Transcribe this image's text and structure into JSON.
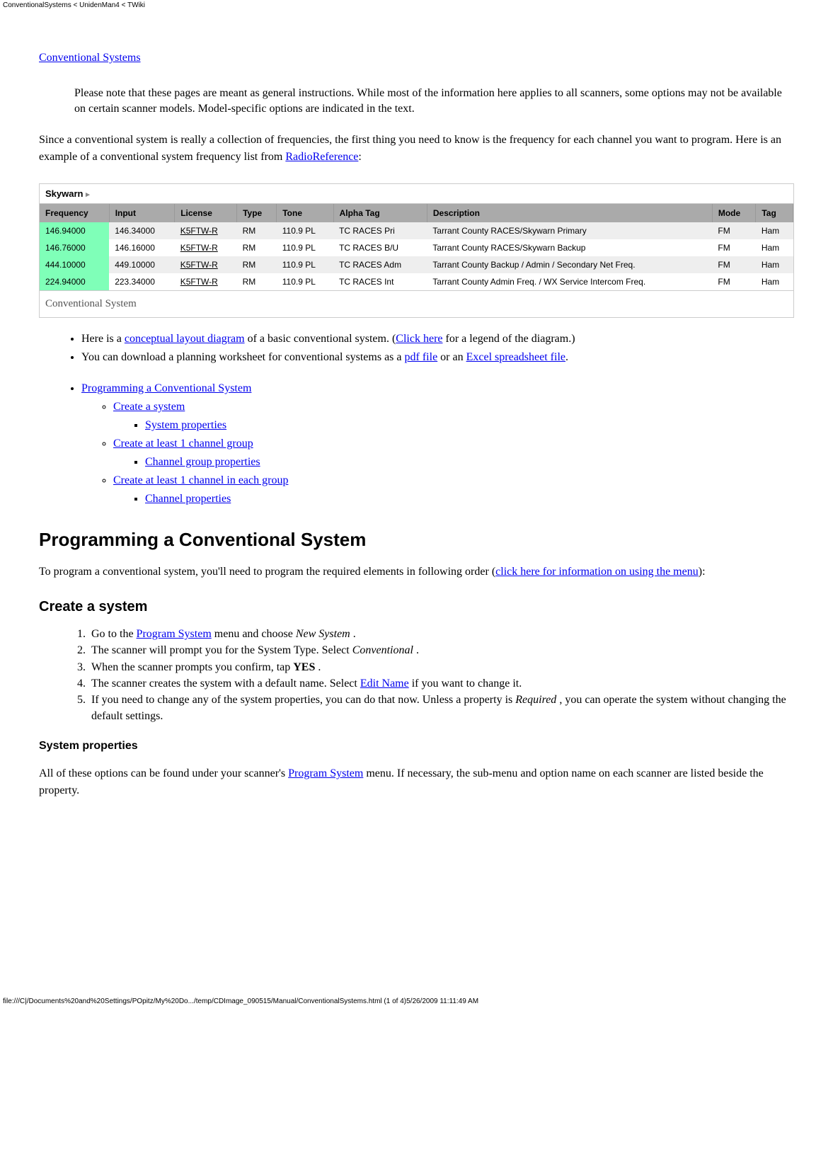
{
  "header_text": "ConventionalSystems < UnidenMan4 < TWiki",
  "title_link": "Conventional Systems",
  "note_para": "Please note that these pages are meant as general instructions. While most of the information here applies to all scanners, some options may not be available on certain scanner models. Model-specific options are indicated in the text.",
  "intro_pre": "Since a conventional system is really a collection of frequencies, the first thing you need to know is the frequency for each channel you want to program. Here is an example of a conventional system frequency list from ",
  "intro_link": "RadioReference",
  "intro_post": ":",
  "skywarn_label": "Skywarn",
  "table_headers": [
    "Frequency",
    "Input",
    "License",
    "Type",
    "Tone",
    "Alpha Tag",
    "Description",
    "Mode",
    "Tag"
  ],
  "rows": [
    {
      "freq": "146.94000",
      "input": "146.34000",
      "lic": "K5FTW-R",
      "type": "RM",
      "tone": "110.9 PL",
      "tag": "TC RACES Pri",
      "desc": "Tarrant County RACES/Skywarn Primary",
      "mode": "FM",
      "cat": "Ham"
    },
    {
      "freq": "146.76000",
      "input": "146.16000",
      "lic": "K5FTW-R",
      "type": "RM",
      "tone": "110.9 PL",
      "tag": "TC RACES B/U",
      "desc": "Tarrant County RACES/Skywarn Backup",
      "mode": "FM",
      "cat": "Ham"
    },
    {
      "freq": "444.10000",
      "input": "449.10000",
      "lic": "K5FTW-R",
      "type": "RM",
      "tone": "110.9 PL",
      "tag": "TC RACES Adm",
      "desc": "Tarrant County Backup / Admin / Secondary Net Freq.",
      "mode": "FM",
      "cat": "Ham"
    },
    {
      "freq": "224.94000",
      "input": "223.34000",
      "lic": "K5FTW-R",
      "type": "RM",
      "tone": "110.9 PL",
      "tag": "TC RACES Int",
      "desc": "Tarrant County Admin Freq. / WX Service Intercom Freq.",
      "mode": "FM",
      "cat": "Ham"
    }
  ],
  "caption": "Conventional System",
  "b1_pre": "Here is a ",
  "b1_l1": "conceptual layout diagram",
  "b1_mid": " of a basic conventional system. (",
  "b1_l2": "Click here",
  "b1_post": " for a legend of the diagram.)",
  "b2_pre": "You can download a planning worksheet for conventional systems as a ",
  "b2_l1": "pdf file",
  "b2_mid": " or an ",
  "b2_l2": "Excel spreadsheet file",
  "b2_post": ".",
  "toc": {
    "l1": "Programming a Conventional System",
    "l2a": "Create a system",
    "l3a": "System properties",
    "l2b": "Create at least 1 channel group",
    "l3b": "Channel group properties",
    "l2c": "Create at least 1 channel in each group",
    "l3c": "Channel properties"
  },
  "h1": "Programming a Conventional System",
  "prog_para_pre": "To program a conventional system, you'll need to program the required elements in following order (",
  "prog_para_link": "click here for information on using the menu",
  "prog_para_post": "):",
  "h2": "Create a system",
  "ol1_pre": "Go to the ",
  "ol1_link": "Program System",
  "ol1_mid": " menu and choose ",
  "ol1_em": "New System",
  "ol1_post": " .",
  "ol2_pre": "The scanner will prompt you for the System Type. Select ",
  "ol2_em": "Conventional",
  "ol2_post": " .",
  "ol3_pre": "When the scanner prompts you confirm, tap ",
  "ol3_b": "YES",
  "ol3_post": " .",
  "ol4_pre": "The scanner creates the system with a default name. Select ",
  "ol4_link": "Edit Name",
  "ol4_post": " if you want to change it.",
  "ol5_pre": "If you need to change any of the system properties, you can do that now. Unless a property is ",
  "ol5_em": "Required",
  "ol5_post": " , you can operate the system without changing the default settings.",
  "h3": "System properties",
  "sys_para_pre": "All of these options can be found under your scanner's ",
  "sys_para_link": "Program System",
  "sys_para_post": " menu. If necessary, the sub-menu and option name on each scanner are listed beside the property.",
  "footer": "file:///C|/Documents%20and%20Settings/POpitz/My%20Do.../temp/CDImage_090515/Manual/ConventionalSystems.html (1 of 4)5/26/2009 11:11:49 AM"
}
